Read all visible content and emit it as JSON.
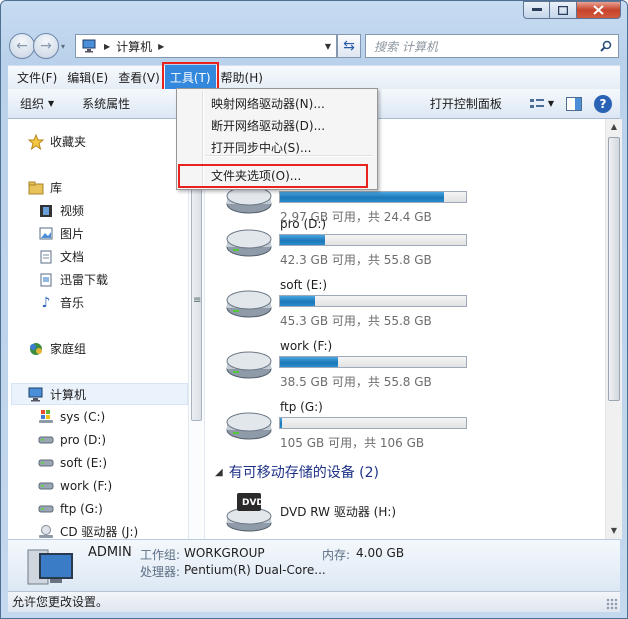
{
  "address": {
    "path_segments": [
      "计算机"
    ]
  },
  "search": {
    "placeholder": "搜索 计算机"
  },
  "menubar": [
    "文件(F)",
    "编辑(E)",
    "查看(V)",
    "工具(T)",
    "帮助(H)"
  ],
  "toolbar": {
    "organize": "组织",
    "system_properties": "系统属性",
    "open_control_panel": "打开控制面板"
  },
  "tools_menu": {
    "items": [
      "映射网络驱动器(N)...",
      "断开网络驱动器(D)...",
      "打开同步中心(S)..."
    ],
    "folder_options": "文件夹选项(O)..."
  },
  "sidebar": {
    "favorites": "收藏夹",
    "libraries": "库",
    "library_items": [
      "视频",
      "图片",
      "文档",
      "迅雷下载",
      "音乐"
    ],
    "homegroup": "家庭组",
    "computer": "计算机",
    "drives": [
      "sys (C:)",
      "pro (D:)",
      "soft (E:)",
      "work (F:)",
      "ftp (G:)",
      "CD 驱动器 (J:)"
    ]
  },
  "drives": [
    {
      "name": "",
      "info": "2.97 GB 可用，共 24.4 GB",
      "used_fraction": 0.88
    },
    {
      "name": "pro (D:)",
      "info": "42.3 GB 可用，共 55.8 GB",
      "used_fraction": 0.24
    },
    {
      "name": "soft (E:)",
      "info": "45.3 GB 可用，共 55.8 GB",
      "used_fraction": 0.19
    },
    {
      "name": "work (F:)",
      "info": "38.5 GB 可用，共 55.8 GB",
      "used_fraction": 0.31
    },
    {
      "name": "ftp (G:)",
      "info": "105 GB 可用，共 106 GB",
      "used_fraction": 0.01
    }
  ],
  "removable": {
    "header": "有可移动存储的设备 (2)",
    "dvd_name": "DVD RW 驱动器 (H:)",
    "dvd_label": "DVD"
  },
  "details": {
    "name": "ADMIN",
    "workgroup_label": "工作组:",
    "workgroup": "WORKGROUP",
    "memory_label": "内存:",
    "memory": "4.00 GB",
    "cpu_label": "处理器:",
    "cpu": "Pentium(R) Dual-Core..."
  },
  "status": {
    "text": "允许您更改设置。"
  },
  "colors": {
    "menu_active": "#3388dd",
    "highlight_box": "#e8221e",
    "bar_fill": "#1c78b8"
  }
}
